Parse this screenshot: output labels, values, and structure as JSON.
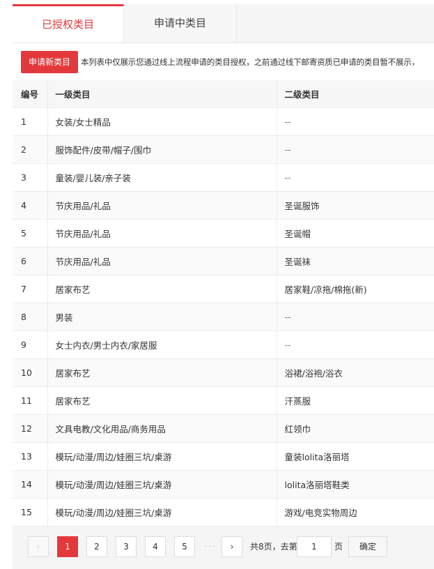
{
  "tabs": [
    {
      "label": "已授权类目",
      "active": true
    },
    {
      "label": "申请中类目",
      "active": false
    }
  ],
  "toolbar": {
    "apply_label": "申请新类目",
    "notice": "本列表中仅展示您通过线上流程申请的类目授权，之前通过线下邮寄资质已申请的类目暂不展示，"
  },
  "table": {
    "headers": [
      "编号",
      "一级类目",
      "二级类目"
    ],
    "rows": [
      [
        "1",
        "女装/女士精品",
        "--"
      ],
      [
        "2",
        "服饰配件/皮带/帽子/围巾",
        "--"
      ],
      [
        "3",
        "童装/婴儿装/亲子装",
        "--"
      ],
      [
        "4",
        "节庆用品/礼品",
        "圣诞服饰"
      ],
      [
        "5",
        "节庆用品/礼品",
        "圣诞帽"
      ],
      [
        "6",
        "节庆用品/礼品",
        "圣诞袜"
      ],
      [
        "7",
        "居家布艺",
        "居家鞋/凉拖/棉拖(新)"
      ],
      [
        "8",
        "男装",
        "--"
      ],
      [
        "9",
        "女士内衣/男士内衣/家居服",
        "--"
      ],
      [
        "10",
        "居家布艺",
        "浴裙/浴袍/浴衣"
      ],
      [
        "11",
        "居家布艺",
        "汗蒸服"
      ],
      [
        "12",
        "文具电教/文化用品/商务用品",
        "红领巾"
      ],
      [
        "13",
        "模玩/动漫/周边/娃圈三坑/桌游",
        "童装lolita洛丽塔"
      ],
      [
        "14",
        "模玩/动漫/周边/娃圈三坑/桌游",
        "lolita洛丽塔鞋类"
      ],
      [
        "15",
        "模玩/动漫/周边/娃圈三坑/桌游",
        "游戏/电竞实物周边"
      ]
    ]
  },
  "pagination": {
    "prev": "‹",
    "next": "›",
    "pages": [
      "1",
      "2",
      "3",
      "4",
      "5"
    ],
    "current_page": "1",
    "ellipsis": "···",
    "total_text": "共8页，去第",
    "goto_value": "1",
    "page_unit": "页",
    "confirm_label": "确定"
  },
  "colors": {
    "accent": "#e4393c",
    "header_bg": "#f7f7f7",
    "border": "#ececec"
  }
}
